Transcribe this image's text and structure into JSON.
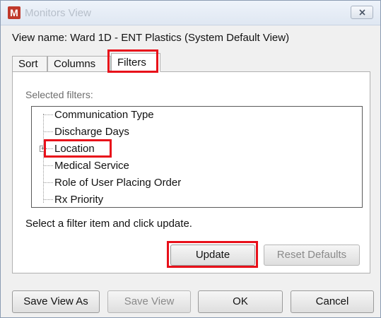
{
  "window": {
    "app_icon": "M",
    "title": "Monitors View"
  },
  "view_name": "View name: Ward 1D - ENT Plastics (System Default View)",
  "tabs": [
    {
      "label": "Sort"
    },
    {
      "label": "Columns"
    },
    {
      "label": "Filters",
      "selected": true
    }
  ],
  "filters": {
    "section_label": "Selected filters:",
    "items": [
      {
        "label": "Communication Type"
      },
      {
        "label": "Discharge Days"
      },
      {
        "label": "Location",
        "expandable": true
      },
      {
        "label": "Medical Service"
      },
      {
        "label": "Role of User Placing Order"
      },
      {
        "label": "Rx Priority"
      }
    ],
    "hint": "Select a filter item and click update.",
    "update_label": "Update",
    "reset_label": "Reset Defaults"
  },
  "footer": {
    "save_view_as": "Save View As",
    "save_view": "Save View",
    "ok": "OK",
    "cancel": "Cancel"
  },
  "colors": {
    "highlight": "#e8101a",
    "disabled_text": "#8a8a8a"
  }
}
